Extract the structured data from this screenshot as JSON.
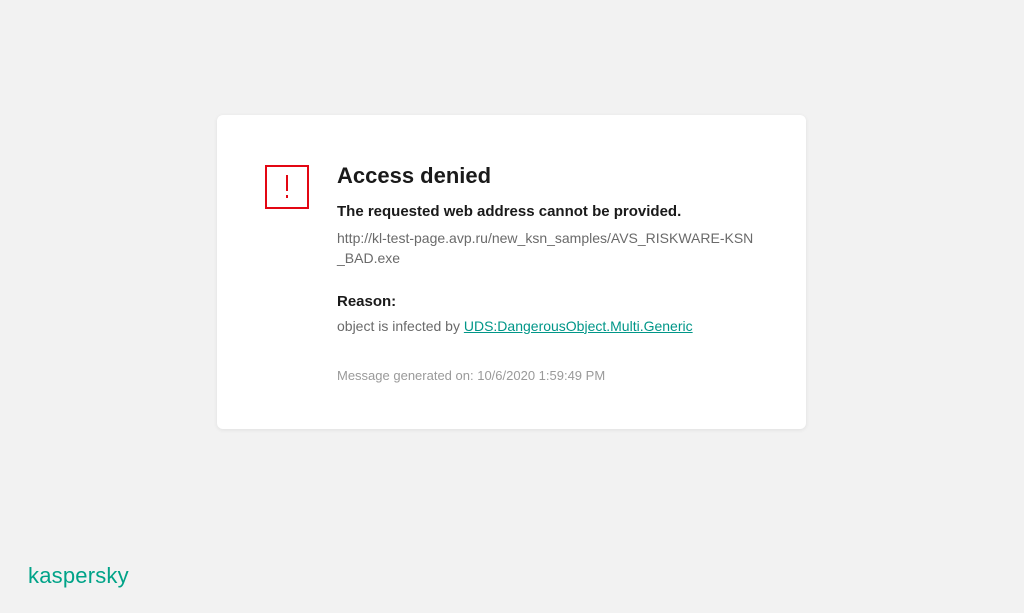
{
  "dialog": {
    "title": "Access denied",
    "subtitle": "The requested web address cannot be provided.",
    "url": "http://kl-test-page.avp.ru/new_ksn_samples/AVS_RISKWARE-KSN_BAD.exe",
    "reason_label": "Reason:",
    "reason_prefix": "object is infected by ",
    "threat_name": "UDS:DangerousObject.Multi.Generic",
    "generated_prefix": "Message generated on: ",
    "generated_time": "10/6/2020 1:59:49 PM"
  },
  "brand": "kaspersky",
  "colors": {
    "accent_red": "#e30613",
    "link_teal": "#009688",
    "brand_teal": "#00a388"
  }
}
